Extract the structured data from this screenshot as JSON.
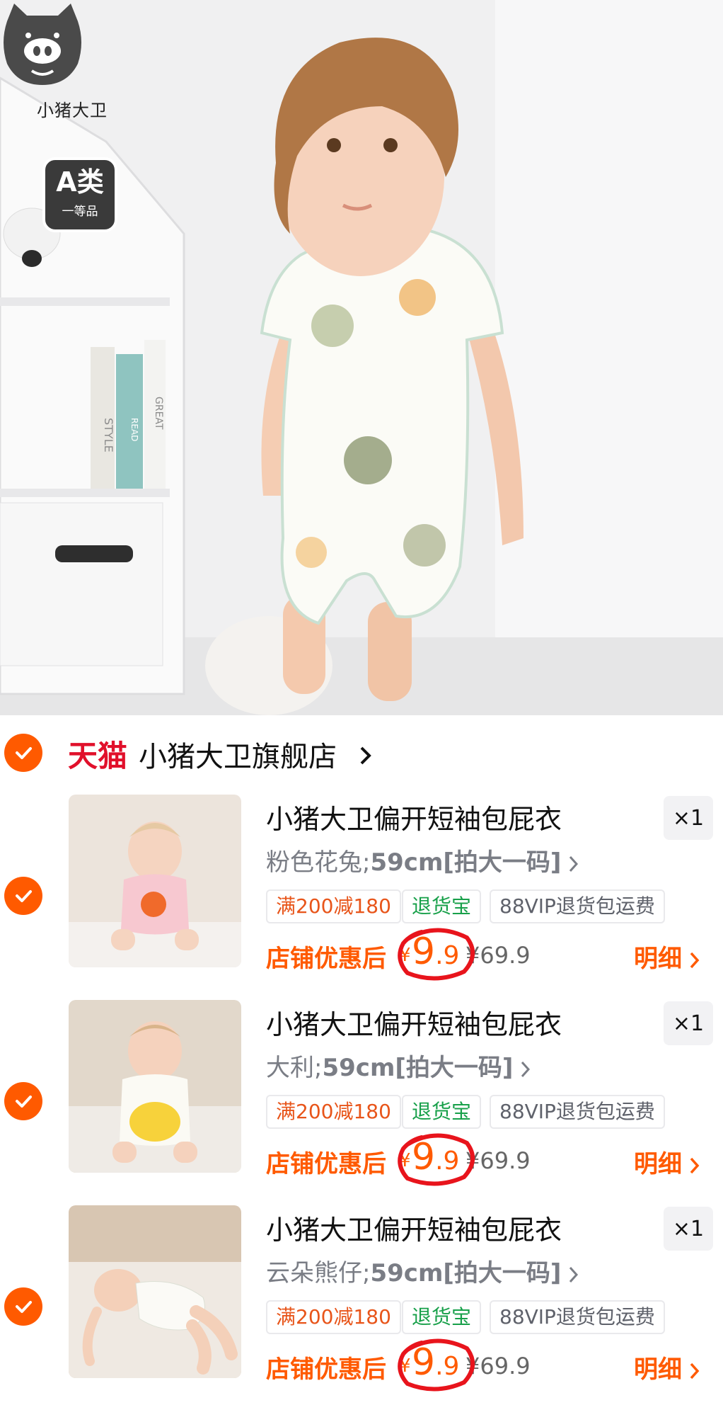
{
  "hero": {
    "brand_text": "小猪大卫",
    "cert_big": "A类",
    "cert_small": "一等品",
    "spine_texts": [
      "STYLE",
      "READ",
      "GREAT"
    ]
  },
  "shop": {
    "platform": "天猫",
    "name": "小猪大卫旗舰店"
  },
  "items": [
    {
      "title": "小猪大卫偏开短袖包屁衣",
      "qty": "×1",
      "variant_color": "粉色花兔;",
      "variant_size": "59cm",
      "variant_note": "[拍大一码]",
      "tag_promo": "满200减180",
      "tag_return": "退货宝",
      "tag_vip": "88VIP退货包运费",
      "price_label": "店铺优惠后",
      "currency": "¥",
      "price_int": "9",
      "price_dec": ".9",
      "original_price": "¥69.9",
      "detail": "明细"
    },
    {
      "title": "小猪大卫偏开短袖包屁衣",
      "qty": "×1",
      "variant_color": "大利;",
      "variant_size": "59cm",
      "variant_note": "[拍大一码]",
      "tag_promo": "满200减180",
      "tag_return": "退货宝",
      "tag_vip": "88VIP退货包运费",
      "price_label": "店铺优惠后",
      "currency": "¥",
      "price_int": "9",
      "price_dec": ".9",
      "original_price": "¥69.9",
      "detail": "明细"
    },
    {
      "title": "小猪大卫偏开短袖包屁衣",
      "qty": "×1",
      "variant_color": "云朵熊仔;",
      "variant_size": "59cm",
      "variant_note": "[拍大一码]",
      "tag_promo": "满200减180",
      "tag_return": "退货宝",
      "tag_vip": "88VIP退货包运费",
      "price_label": "店铺优惠后",
      "currency": "¥",
      "price_int": "9",
      "price_dec": ".9",
      "original_price": "¥69.9",
      "detail": "明细"
    }
  ],
  "colors": {
    "accent": "#ff5a00",
    "tmall_red": "#e1102b",
    "return_green": "#18a04a",
    "circle_red": "#e8141c"
  }
}
